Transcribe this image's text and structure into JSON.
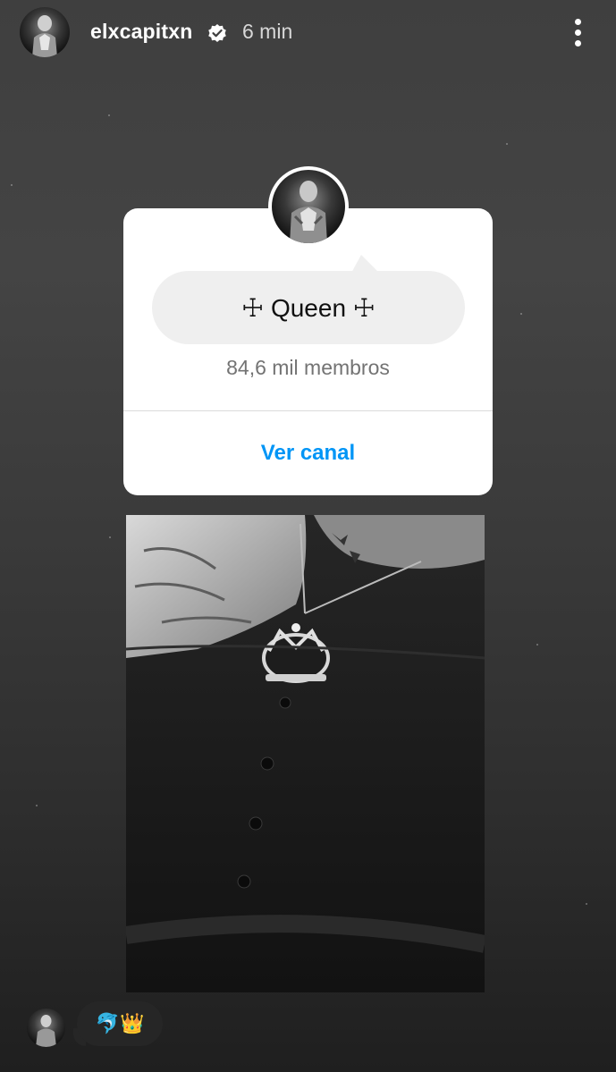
{
  "header": {
    "username": "elxcapitxn",
    "verified_icon": "verified-badge-icon",
    "time": "6 min",
    "more_icon": "more-vertical-icon"
  },
  "channel_card": {
    "channel_name": "☩ Queen ☩",
    "members": "84,6 mil membros",
    "view_button": "Ver canal"
  },
  "reply": {
    "text": "🐬👑"
  },
  "colors": {
    "link_blue": "#0095f6",
    "card_bg": "#ffffff",
    "bubble_bg": "#efefef"
  }
}
